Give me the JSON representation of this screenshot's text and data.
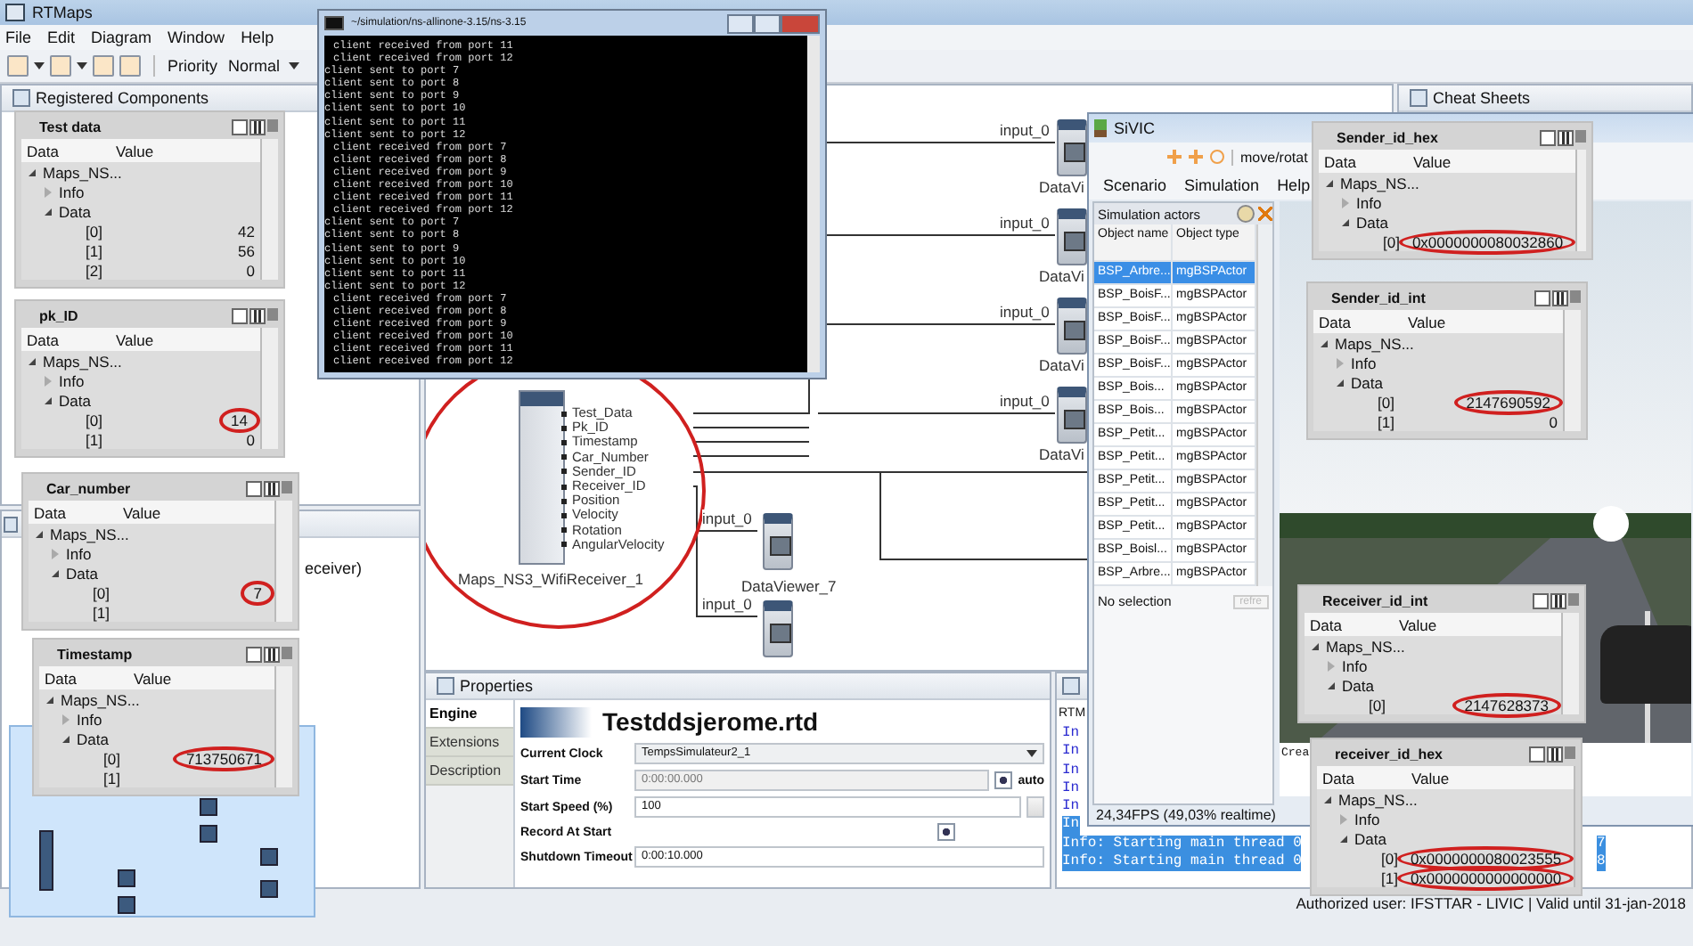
{
  "app": {
    "title": "RTMaps",
    "menu": [
      "File",
      "Edit",
      "Diagram",
      "Window",
      "Help"
    ],
    "toolbar": {
      "priority_label": "Priority",
      "priority_value": "Normal"
    }
  },
  "registered_components": {
    "title": "Registered Components"
  },
  "outline": {
    "fragment": "eceiver)"
  },
  "viewers": [
    {
      "title": "Test data",
      "columns": [
        "Data",
        "Value"
      ],
      "tree": [
        {
          "label": "Maps_NS...",
          "expanded": true,
          "children": [
            {
              "label": "Info",
              "expanded": false
            },
            {
              "label": "Data",
              "expanded": true,
              "children": [
                {
                  "label": "[0]",
                  "value": "42",
                  "circled": false
                },
                {
                  "label": "[1]",
                  "value": "56",
                  "circled": false
                },
                {
                  "label": "[2]",
                  "value": "0",
                  "circled": false
                }
              ]
            }
          ]
        }
      ]
    },
    {
      "title": "pk_ID",
      "columns": [
        "Data",
        "Value"
      ],
      "tree": [
        {
          "label": "Maps_NS...",
          "expanded": true,
          "children": [
            {
              "label": "Info",
              "expanded": false
            },
            {
              "label": "Data",
              "expanded": true,
              "children": [
                {
                  "label": "[0]",
                  "value": "14",
                  "circled": true
                },
                {
                  "label": "[1]",
                  "value": "0",
                  "circled": false
                }
              ]
            }
          ]
        }
      ]
    },
    {
      "title": "Car_number",
      "columns": [
        "Data",
        "Value"
      ],
      "tree": [
        {
          "label": "Maps_NS...",
          "expanded": true,
          "children": [
            {
              "label": "Info",
              "expanded": false
            },
            {
              "label": "Data",
              "expanded": true,
              "children": [
                {
                  "label": "[0]",
                  "value": "7",
                  "circled": true
                },
                {
                  "label": "[1]"
                }
              ]
            }
          ]
        }
      ]
    },
    {
      "title": "Timestamp",
      "columns": [
        "Data",
        "Value"
      ],
      "tree": [
        {
          "label": "Maps_NS...",
          "expanded": true,
          "children": [
            {
              "label": "Info",
              "expanded": false
            },
            {
              "label": "Data",
              "expanded": true,
              "children": [
                {
                  "label": "[0]",
                  "value": "713750671",
                  "circled": true
                },
                {
                  "label": "[1]"
                }
              ]
            }
          ]
        }
      ]
    },
    {
      "title": "Sender_id_hex",
      "columns": [
        "Data",
        "Value"
      ],
      "tree": [
        {
          "label": "Maps_NS...",
          "expanded": true,
          "children": [
            {
              "label": "Info",
              "expanded": false
            },
            {
              "label": "Data",
              "expanded": true,
              "children": [
                {
                  "label": "[0]",
                  "value": "0x0000000080032860",
                  "circled": true
                }
              ]
            }
          ]
        }
      ]
    },
    {
      "title": "Sender_id_int",
      "columns": [
        "Data",
        "Value"
      ],
      "tree": [
        {
          "label": "Maps_NS...",
          "expanded": true,
          "children": [
            {
              "label": "Info",
              "expanded": false
            },
            {
              "label": "Data",
              "expanded": true,
              "children": [
                {
                  "label": "[0]",
                  "value": "2147690592",
                  "circled": true
                },
                {
                  "label": "[1]",
                  "value": "0",
                  "circled": false
                }
              ]
            }
          ]
        }
      ]
    },
    {
      "title": "Receiver_id_int",
      "columns": [
        "Data",
        "Value"
      ],
      "tree": [
        {
          "label": "Maps_NS...",
          "expanded": true,
          "children": [
            {
              "label": "Info",
              "expanded": false
            },
            {
              "label": "Data",
              "expanded": true,
              "children": [
                {
                  "label": "[0]",
                  "value": "2147628373",
                  "circled": true
                }
              ]
            }
          ]
        }
      ]
    },
    {
      "title": "receiver_id_hex",
      "columns": [
        "Data",
        "Value"
      ],
      "tree": [
        {
          "label": "Maps_NS...",
          "expanded": true,
          "children": [
            {
              "label": "Info",
              "expanded": false
            },
            {
              "label": "Data",
              "expanded": true,
              "children": [
                {
                  "label": "[0]",
                  "value": "0x0000000080023555",
                  "circled": true
                },
                {
                  "label": "[1]",
                  "value": "0x0000000000000000",
                  "circled": true
                }
              ]
            }
          ]
        }
      ]
    }
  ],
  "terminal": {
    "title": "~/simulation/ns-allinone-3.15/ns-3.15",
    "lines": [
      {
        "kind": "received",
        "text": "client received from port 11"
      },
      {
        "kind": "received",
        "text": "client received from port 12"
      },
      {
        "kind": "sent",
        "text": "client sent to port 7"
      },
      {
        "kind": "sent",
        "text": "client sent to port 8"
      },
      {
        "kind": "sent",
        "text": "client sent to port 9"
      },
      {
        "kind": "sent",
        "text": "client sent to port 10"
      },
      {
        "kind": "sent",
        "text": "client sent to port 11"
      },
      {
        "kind": "sent",
        "text": "client sent to port 12"
      },
      {
        "kind": "received",
        "text": "client received from port 7"
      },
      {
        "kind": "received",
        "text": "client received from port 8"
      },
      {
        "kind": "received",
        "text": "client received from port 9"
      },
      {
        "kind": "received",
        "text": "client received from port 10"
      },
      {
        "kind": "received",
        "text": "client received from port 11"
      },
      {
        "kind": "received",
        "text": "client received from port 12"
      },
      {
        "kind": "sent",
        "text": "client sent to port 7"
      },
      {
        "kind": "sent",
        "text": "client sent to port 8"
      },
      {
        "kind": "sent",
        "text": "client sent to port 9"
      },
      {
        "kind": "sent",
        "text": "client sent to port 10"
      },
      {
        "kind": "sent",
        "text": "client sent to port 11"
      },
      {
        "kind": "sent",
        "text": "client sent to port 12"
      },
      {
        "kind": "received",
        "text": "client received from port 7"
      },
      {
        "kind": "received",
        "text": "client received from port 8"
      },
      {
        "kind": "received",
        "text": "client received from port 9"
      },
      {
        "kind": "received",
        "text": "client received from port 10"
      },
      {
        "kind": "received",
        "text": "client received from port 11"
      },
      {
        "kind": "received",
        "text": "client received from port 12"
      }
    ]
  },
  "diagram": {
    "component": {
      "name": "Maps_NS3_WifiReceiver_1",
      "circled": true,
      "outputs": [
        "Test_Data",
        "Pk_ID",
        "Timestamp",
        "Car_Number",
        "Sender_ID",
        "Receiver_ID",
        "Position",
        "Velocity",
        "Rotation",
        "AngularVelocity"
      ]
    },
    "viewers": [
      {
        "label": "DataVi",
        "input": "input_0"
      },
      {
        "label": "DataVi",
        "input": "input_0"
      },
      {
        "label": "DataVi",
        "input": "input_0"
      },
      {
        "label": "DataVi",
        "input": "input_0"
      },
      {
        "label": "DataViewer_7",
        "input": "input_0"
      },
      {
        "input": "input_0"
      }
    ]
  },
  "properties": {
    "title": "Properties",
    "tabs": [
      {
        "label": "Engine",
        "selected": true
      },
      {
        "label": "Extensions",
        "selected": false
      },
      {
        "label": "Description",
        "selected": false
      }
    ],
    "heading": "Testddsjerome.rtd",
    "fields": [
      {
        "kind": "select",
        "label": "Current Clock",
        "value": "TempsSimulateur2_1"
      },
      {
        "kind": "text",
        "label": "Start Time",
        "value": "0:00:00.000",
        "disabled": true,
        "option": {
          "label": "auto",
          "checked": true
        }
      },
      {
        "kind": "spin",
        "label": "Start Speed (%)",
        "value": "100"
      },
      {
        "kind": "checkbox",
        "label": "Record At Start",
        "checked": true
      },
      {
        "kind": "text",
        "label": "Shutdown Timeout",
        "value": "0:00:10.000",
        "disabled": false
      }
    ]
  },
  "console": {
    "title": "RTM",
    "lines": [
      {
        "text": "In",
        "selected": false
      },
      {
        "text": "In",
        "selected": false
      },
      {
        "text": "In",
        "selected": false
      },
      {
        "text": "In",
        "selected": false
      },
      {
        "text": "In",
        "selected": false
      },
      {
        "text": "In",
        "selected": true
      },
      {
        "text": "Info: Starting main thread 0",
        "tail": "7",
        "selected": true
      },
      {
        "text": "Info: Starting main thread 0",
        "tail": "8",
        "selected": true
      }
    ]
  },
  "cheat_sheets": {
    "title": "Cheat Sheets"
  },
  "sivic": {
    "title": "SiVIC",
    "tool_label": "move/rotat",
    "menu": [
      "Scenario",
      "Simulation",
      "Help"
    ],
    "panel_title": "Simulation actors",
    "columns": [
      "Object name",
      "Object type"
    ],
    "actors": [
      {
        "name": "BSP_Arbre...",
        "type": "mgBSPActor",
        "selected": true
      },
      {
        "name": "BSP_BoisF...",
        "type": "mgBSPActor",
        "selected": false
      },
      {
        "name": "BSP_BoisF...",
        "type": "mgBSPActor",
        "selected": false
      },
      {
        "name": "BSP_BoisF...",
        "type": "mgBSPActor",
        "selected": false
      },
      {
        "name": "BSP_BoisF...",
        "type": "mgBSPActor",
        "selected": false
      },
      {
        "name": "BSP_Bois...",
        "type": "mgBSPActor",
        "selected": false
      },
      {
        "name": "BSP_Bois...",
        "type": "mgBSPActor",
        "selected": false
      },
      {
        "name": "BSP_Petit...",
        "type": "mgBSPActor",
        "selected": false
      },
      {
        "name": "BSP_Petit...",
        "type": "mgBSPActor",
        "selected": false
      },
      {
        "name": "BSP_Petit...",
        "type": "mgBSPActor",
        "selected": false
      },
      {
        "name": "BSP_Petit...",
        "type": "mgBSPActor",
        "selected": false
      },
      {
        "name": "BSP_Petit...",
        "type": "mgBSPActor",
        "selected": false
      },
      {
        "name": "BSP_Boisl...",
        "type": "mgBSPActor",
        "selected": false
      },
      {
        "name": "BSP_Arbre...",
        "type": "mgBSPActor",
        "selected": false
      }
    ],
    "selection_text": "No selection",
    "refresh_label": "refre",
    "log_fragment": "Crea",
    "fps": "24,34FPS (49,03% realtime)"
  },
  "status_bar": "Authorized user: IFSTTAR - LIVIC | Valid until 31-jan-2018"
}
